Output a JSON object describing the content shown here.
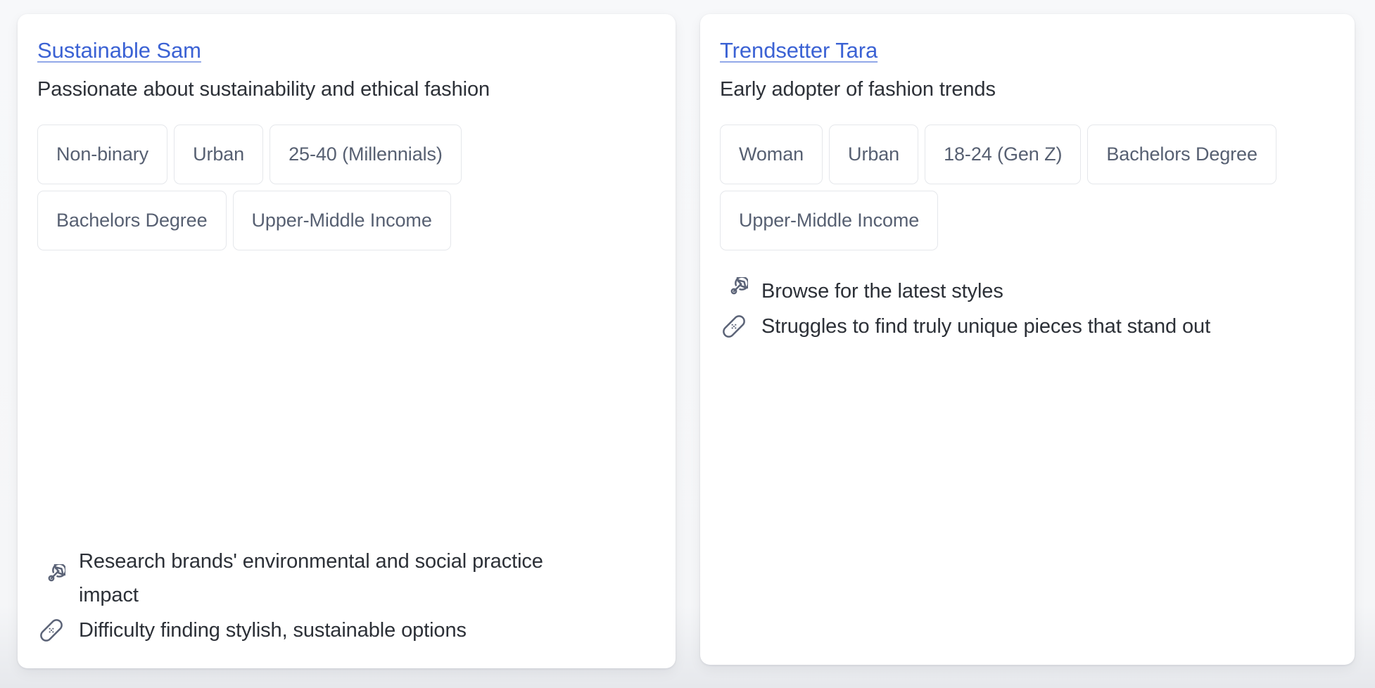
{
  "personas": [
    {
      "name": "Sustainable Sam",
      "description": "Passionate about sustainability and ethical fashion",
      "tags": [
        "Non-binary",
        "Urban",
        "25-40 (Millennials)",
        "Bachelors Degree",
        "Upper-Middle Income"
      ],
      "insights": [
        {
          "icon": "target-icon",
          "text": "Research brands' environmental and social practice impact"
        },
        {
          "icon": "bandage-icon",
          "text": "Difficulty finding stylish, sustainable options"
        }
      ]
    },
    {
      "name": "Trendsetter Tara",
      "description": "Early adopter of fashion trends",
      "tags": [
        "Woman",
        "Urban",
        "18-24 (Gen Z)",
        "Bachelors Degree",
        "Upper-Middle Income"
      ],
      "insights": [
        {
          "icon": "target-icon",
          "text": "Browse for the latest styles"
        },
        {
          "icon": "bandage-icon",
          "text": "Struggles to find truly unique pieces that stand out"
        }
      ]
    }
  ],
  "colors": {
    "link": "#3b62d4",
    "link_underline": "#92a8e8",
    "body_text": "#2c3037",
    "tag_text": "#576072",
    "tag_border": "#e5e7eb",
    "icon": "#5b6377",
    "card_background": "#ffffff",
    "page_background": "#f6f7f9"
  }
}
